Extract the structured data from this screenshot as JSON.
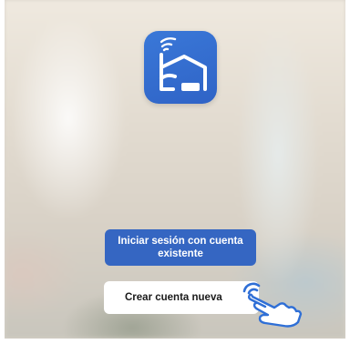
{
  "app": {
    "icon_name": "smart-home-wifi-icon",
    "icon_color": "#3370d2"
  },
  "actions": {
    "login_label": "Iniciar sesión con cuenta existente",
    "create_account_label": "Crear cuenta nueva"
  },
  "pointer": {
    "icon_name": "tap-hand-icon",
    "color": "#2f6fd6"
  }
}
